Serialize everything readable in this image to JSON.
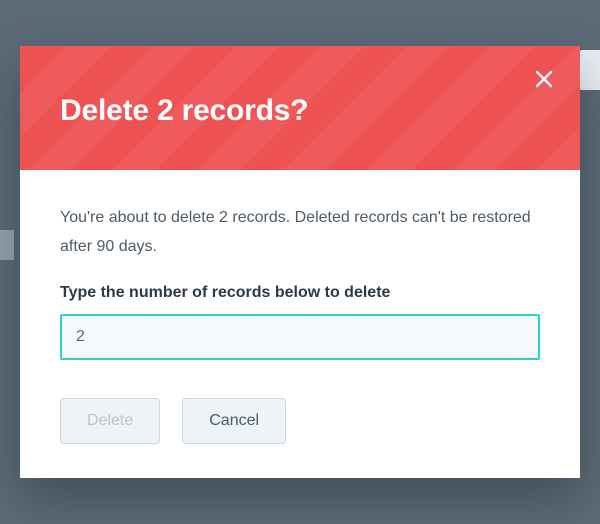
{
  "modal": {
    "title": "Delete 2 records?",
    "warning": "You're about to delete 2 records. Deleted records can't be restored after 90 days.",
    "input_label": "Type the number of records below to delete",
    "input_value": "2",
    "delete_label": "Delete",
    "cancel_label": "Cancel"
  }
}
